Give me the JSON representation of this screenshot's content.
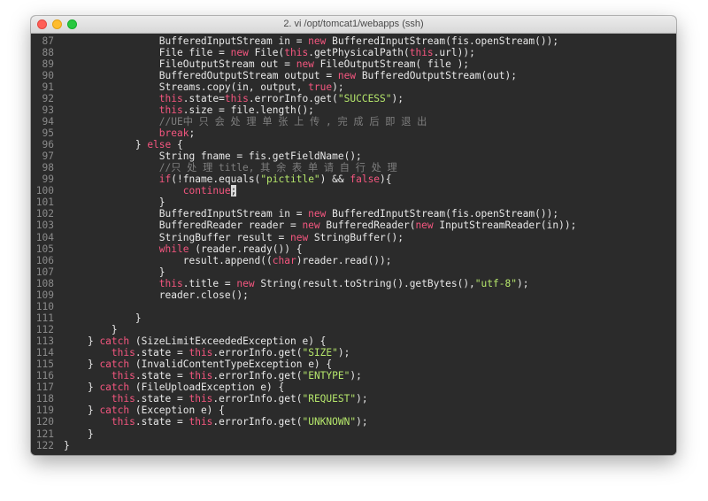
{
  "window": {
    "title": "2. vi  /opt/tomcat1/webapps (ssh)"
  },
  "colors": {
    "keyword": "#f4567f",
    "string": "#b5e66b",
    "comment": "#7f7f7f",
    "text": "#e8e8e8",
    "line_number": "#8a8a8a",
    "background": "#2b2b2b"
  },
  "editor": {
    "lines": [
      {
        "num": "87",
        "indent": 16,
        "tokens": [
          [
            "p",
            "BufferedInputStream in = "
          ],
          [
            "k",
            "new"
          ],
          [
            "p",
            " BufferedInputStream(fis.openStream());"
          ]
        ]
      },
      {
        "num": "88",
        "indent": 16,
        "tokens": [
          [
            "p",
            "File file = "
          ],
          [
            "k",
            "new"
          ],
          [
            "p",
            " File("
          ],
          [
            "k",
            "this"
          ],
          [
            "p",
            ".getPhysicalPath("
          ],
          [
            "k",
            "this"
          ],
          [
            "p",
            ".url));"
          ]
        ]
      },
      {
        "num": "89",
        "indent": 16,
        "tokens": [
          [
            "p",
            "FileOutputStream out = "
          ],
          [
            "k",
            "new"
          ],
          [
            "p",
            " FileOutputStream( file );"
          ]
        ]
      },
      {
        "num": "90",
        "indent": 16,
        "tokens": [
          [
            "p",
            "BufferedOutputStream output = "
          ],
          [
            "k",
            "new"
          ],
          [
            "p",
            " BufferedOutputStream(out);"
          ]
        ]
      },
      {
        "num": "91",
        "indent": 16,
        "tokens": [
          [
            "p",
            "Streams.copy(in, output, "
          ],
          [
            "k",
            "true"
          ],
          [
            "p",
            ");"
          ]
        ]
      },
      {
        "num": "92",
        "indent": 16,
        "tokens": [
          [
            "k",
            "this"
          ],
          [
            "p",
            ".state="
          ],
          [
            "k",
            "this"
          ],
          [
            "p",
            ".errorInfo.get("
          ],
          [
            "s",
            "\"SUCCESS\""
          ],
          [
            "p",
            ");"
          ]
        ]
      },
      {
        "num": "93",
        "indent": 16,
        "tokens": [
          [
            "k",
            "this"
          ],
          [
            "p",
            ".size = file.length();"
          ]
        ]
      },
      {
        "num": "94",
        "indent": 16,
        "tokens": [
          [
            "c",
            "//UE中 只 会 处 理 单 张 上 传 , 完 成 后 即 退 出"
          ]
        ]
      },
      {
        "num": "95",
        "indent": 16,
        "tokens": [
          [
            "k",
            "break"
          ],
          [
            "p",
            ";"
          ]
        ]
      },
      {
        "num": "96",
        "indent": 12,
        "tokens": [
          [
            "p",
            "} "
          ],
          [
            "k",
            "else"
          ],
          [
            "p",
            " {"
          ]
        ]
      },
      {
        "num": "97",
        "indent": 16,
        "tokens": [
          [
            "p",
            "String fname = fis.getFieldName();"
          ]
        ]
      },
      {
        "num": "98",
        "indent": 16,
        "tokens": [
          [
            "c",
            "//只 处 理 title, 其 余 表 单 请 自 行 处 理"
          ]
        ]
      },
      {
        "num": "99",
        "indent": 16,
        "tokens": [
          [
            "k",
            "if"
          ],
          [
            "p",
            "(!fname.equals("
          ],
          [
            "s",
            "\"pictitle\""
          ],
          [
            "p",
            ") && "
          ],
          [
            "k",
            "false"
          ],
          [
            "p",
            "){"
          ]
        ]
      },
      {
        "num": "100",
        "indent": 20,
        "tokens": [
          [
            "k",
            "continue"
          ],
          [
            "cur",
            ";"
          ]
        ]
      },
      {
        "num": "101",
        "indent": 16,
        "tokens": [
          [
            "p",
            "}"
          ]
        ]
      },
      {
        "num": "102",
        "indent": 16,
        "tokens": [
          [
            "p",
            "BufferedInputStream in = "
          ],
          [
            "k",
            "new"
          ],
          [
            "p",
            " BufferedInputStream(fis.openStream());"
          ]
        ]
      },
      {
        "num": "103",
        "indent": 16,
        "tokens": [
          [
            "p",
            "BufferedReader reader = "
          ],
          [
            "k",
            "new"
          ],
          [
            "p",
            " BufferedReader("
          ],
          [
            "k",
            "new"
          ],
          [
            "p",
            " InputStreamReader(in));"
          ]
        ]
      },
      {
        "num": "104",
        "indent": 16,
        "tokens": [
          [
            "p",
            "StringBuffer result = "
          ],
          [
            "k",
            "new"
          ],
          [
            "p",
            " StringBuffer();"
          ]
        ]
      },
      {
        "num": "105",
        "indent": 16,
        "tokens": [
          [
            "k",
            "while"
          ],
          [
            "p",
            " (reader.ready()) {"
          ]
        ]
      },
      {
        "num": "106",
        "indent": 20,
        "tokens": [
          [
            "p",
            "result.append(("
          ],
          [
            "k",
            "char"
          ],
          [
            "p",
            ")reader.read());"
          ]
        ]
      },
      {
        "num": "107",
        "indent": 16,
        "tokens": [
          [
            "p",
            "}"
          ]
        ]
      },
      {
        "num": "108",
        "indent": 16,
        "tokens": [
          [
            "k",
            "this"
          ],
          [
            "p",
            ".title = "
          ],
          [
            "k",
            "new"
          ],
          [
            "p",
            " String(result.toString().getBytes(),"
          ],
          [
            "s",
            "\"utf-8\""
          ],
          [
            "p",
            ");"
          ]
        ]
      },
      {
        "num": "109",
        "indent": 16,
        "tokens": [
          [
            "p",
            "reader.close();"
          ]
        ]
      },
      {
        "num": "110",
        "indent": 0,
        "tokens": []
      },
      {
        "num": "111",
        "indent": 12,
        "tokens": [
          [
            "p",
            "}"
          ]
        ]
      },
      {
        "num": "112",
        "indent": 8,
        "tokens": [
          [
            "p",
            "}"
          ]
        ]
      },
      {
        "num": "113",
        "indent": 4,
        "tokens": [
          [
            "p",
            "} "
          ],
          [
            "k",
            "catch"
          ],
          [
            "p",
            " (SizeLimitExceededException e) {"
          ]
        ]
      },
      {
        "num": "114",
        "indent": 8,
        "tokens": [
          [
            "k",
            "this"
          ],
          [
            "p",
            ".state = "
          ],
          [
            "k",
            "this"
          ],
          [
            "p",
            ".errorInfo.get("
          ],
          [
            "s",
            "\"SIZE\""
          ],
          [
            "p",
            ");"
          ]
        ]
      },
      {
        "num": "115",
        "indent": 4,
        "tokens": [
          [
            "p",
            "} "
          ],
          [
            "k",
            "catch"
          ],
          [
            "p",
            " (InvalidContentTypeException e) {"
          ]
        ]
      },
      {
        "num": "116",
        "indent": 8,
        "tokens": [
          [
            "k",
            "this"
          ],
          [
            "p",
            ".state = "
          ],
          [
            "k",
            "this"
          ],
          [
            "p",
            ".errorInfo.get("
          ],
          [
            "s",
            "\"ENTYPE\""
          ],
          [
            "p",
            ");"
          ]
        ]
      },
      {
        "num": "117",
        "indent": 4,
        "tokens": [
          [
            "p",
            "} "
          ],
          [
            "k",
            "catch"
          ],
          [
            "p",
            " (FileUploadException e) {"
          ]
        ]
      },
      {
        "num": "118",
        "indent": 8,
        "tokens": [
          [
            "k",
            "this"
          ],
          [
            "p",
            ".state = "
          ],
          [
            "k",
            "this"
          ],
          [
            "p",
            ".errorInfo.get("
          ],
          [
            "s",
            "\"REQUEST\""
          ],
          [
            "p",
            ");"
          ]
        ]
      },
      {
        "num": "119",
        "indent": 4,
        "tokens": [
          [
            "p",
            "} "
          ],
          [
            "k",
            "catch"
          ],
          [
            "p",
            " (Exception e) {"
          ]
        ]
      },
      {
        "num": "120",
        "indent": 8,
        "tokens": [
          [
            "k",
            "this"
          ],
          [
            "p",
            ".state = "
          ],
          [
            "k",
            "this"
          ],
          [
            "p",
            ".errorInfo.get("
          ],
          [
            "s",
            "\"UNKNOWN\""
          ],
          [
            "p",
            ");"
          ]
        ]
      },
      {
        "num": "121",
        "indent": 4,
        "tokens": [
          [
            "p",
            "}"
          ]
        ]
      },
      {
        "num": "122",
        "indent": 0,
        "tokens": [
          [
            "p",
            "}"
          ]
        ]
      }
    ]
  }
}
